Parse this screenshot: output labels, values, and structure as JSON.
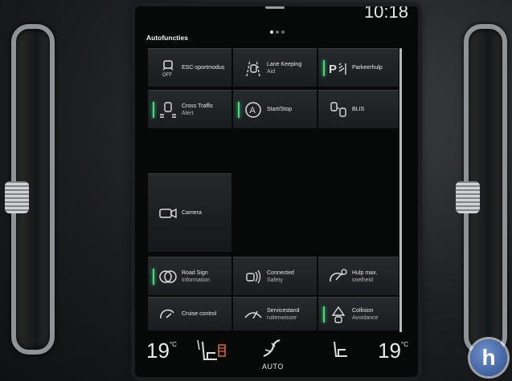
{
  "status": {
    "clock": "10:18",
    "pages": 3,
    "active_page": 1
  },
  "section_title": "Autofuncties",
  "tiles": [
    {
      "label": "ESC-sportmodus",
      "sub": "",
      "icon": "esc-off-icon",
      "active": false
    },
    {
      "label": "Lane Keeping",
      "sub": "Aid",
      "icon": "lane-keeping-icon",
      "active": false
    },
    {
      "label": "Parkeerhulp",
      "sub": "",
      "icon": "parking-assist-icon",
      "active": true
    },
    {
      "label": "Cross Traffic",
      "sub": "Alert",
      "icon": "cross-traffic-icon",
      "active": true
    },
    {
      "label": "Start/Stop",
      "sub": "",
      "icon": "start-stop-icon",
      "active": true
    },
    {
      "label": "BLIS",
      "sub": "",
      "icon": "blis-icon",
      "active": false
    },
    {
      "label": "Camera",
      "sub": "",
      "icon": "camera-icon",
      "active": false
    },
    {
      "label": "Road Sign",
      "sub": "Information",
      "icon": "road-sign-icon",
      "active": true
    },
    {
      "label": "Connected",
      "sub": "Safety",
      "icon": "connected-safety-icon",
      "active": false
    },
    {
      "label": "Hulp max.",
      "sub": "snelheid",
      "icon": "speed-limiter-icon",
      "active": false
    },
    {
      "label": "Cruise control",
      "sub": "",
      "icon": "cruise-control-icon",
      "active": false
    },
    {
      "label": "Servicestand",
      "sub": "ruitenwisser",
      "icon": "wiper-service-icon",
      "active": false
    },
    {
      "label": "Collision",
      "sub": "Avoidance",
      "icon": "collision-avoidance-icon",
      "active": true
    }
  ],
  "climate": {
    "left_temp": "19",
    "right_temp": "19",
    "unit": "°C",
    "fan_mode": "AUTO"
  },
  "colors": {
    "active_led": "#3fe07a",
    "tile_bg": "#262a2d",
    "text": "#e9e9e9"
  }
}
